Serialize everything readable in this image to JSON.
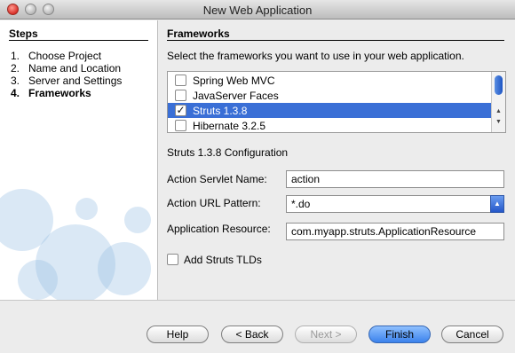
{
  "window": {
    "title": "New Web Application"
  },
  "steps": {
    "title": "Steps",
    "items": [
      {
        "num": "1.",
        "label": "Choose Project"
      },
      {
        "num": "2.",
        "label": "Name and Location"
      },
      {
        "num": "3.",
        "label": "Server and Settings"
      },
      {
        "num": "4.",
        "label": "Frameworks"
      }
    ]
  },
  "frameworks": {
    "title": "Frameworks",
    "instruction": "Select the frameworks you want to use in your web application.",
    "list": [
      {
        "label": "Spring Web MVC",
        "checked": false,
        "selected": false
      },
      {
        "label": "JavaServer Faces",
        "checked": false,
        "selected": false
      },
      {
        "label": "Struts 1.3.8",
        "checked": true,
        "selected": true
      },
      {
        "label": "Hibernate 3.2.5",
        "checked": false,
        "selected": false
      }
    ]
  },
  "config": {
    "title": "Struts 1.3.8 Configuration",
    "servlet_name_label": "Action Servlet Name:",
    "servlet_name_value": "action",
    "url_pattern_label": "Action URL Pattern:",
    "url_pattern_value": "*.do",
    "resource_label": "Application Resource:",
    "resource_value": "com.myapp.struts.ApplicationResource",
    "tlds_label": "Add Struts TLDs",
    "tlds_checked": false
  },
  "buttons": {
    "help": "Help",
    "back": "< Back",
    "next": "Next >",
    "finish": "Finish",
    "cancel": "Cancel"
  },
  "colors": {
    "selection": "#3a6fd6",
    "accent": "#3b82ec"
  }
}
